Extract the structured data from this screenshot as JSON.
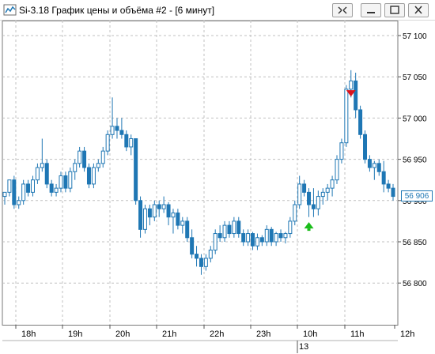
{
  "window": {
    "title": "Si-3.18 График цены и объёма #2 - [6 минут]"
  },
  "icons": {
    "app": "chart-window-icon",
    "restore": "restore-window-icon",
    "minimize": "minimize-icon",
    "maximize": "maximize-icon",
    "close": "close-icon"
  },
  "colors": {
    "candle": "#1f77b4",
    "grid": "#c0c0c0",
    "sell_signal": "#d9141e",
    "buy_signal": "#1bbd1b"
  },
  "price_axis": {
    "labels": [
      "57 100",
      "57 050",
      "57 000",
      "56 950",
      "56 900",
      "56 850",
      "56 800"
    ]
  },
  "current_price": "56 906",
  "date_label": "13",
  "chart_data": {
    "type": "candlestick",
    "ylim": [
      56760,
      57120
    ],
    "grid": true,
    "x_ticks": [
      "18h",
      "19h",
      "20h",
      "21h",
      "22h",
      "23h",
      "10h",
      "11h",
      "12h"
    ],
    "candles": [
      [
        56905,
        56908,
        56895,
        56910
      ],
      [
        56910,
        56925,
        56905,
        56925
      ],
      [
        56925,
        56930,
        56890,
        56895
      ],
      [
        56895,
        56905,
        56890,
        56900
      ],
      [
        56900,
        56925,
        56895,
        56920
      ],
      [
        56920,
        56925,
        56905,
        56910
      ],
      [
        56910,
        56930,
        56905,
        56925
      ],
      [
        56925,
        56945,
        56920,
        56940
      ],
      [
        56940,
        56975,
        56935,
        56945
      ],
      [
        56945,
        56950,
        56915,
        56920
      ],
      [
        56920,
        56925,
        56905,
        56910
      ],
      [
        56910,
        56920,
        56905,
        56915
      ],
      [
        56915,
        56935,
        56910,
        56930
      ],
      [
        56930,
        56935,
        56910,
        56915
      ],
      [
        56915,
        56940,
        56910,
        56935
      ],
      [
        56935,
        56950,
        56925,
        56945
      ],
      [
        56945,
        56965,
        56940,
        56960
      ],
      [
        56960,
        56965,
        56935,
        56940
      ],
      [
        56940,
        56945,
        56915,
        56920
      ],
      [
        56920,
        56945,
        56915,
        56940
      ],
      [
        56940,
        56950,
        56935,
        56945
      ],
      [
        56945,
        56965,
        56940,
        56960
      ],
      [
        56960,
        56985,
        56955,
        56980
      ],
      [
        56980,
        57025,
        56975,
        56990
      ],
      [
        56990,
        57000,
        56975,
        56985
      ],
      [
        56985,
        57000,
        56975,
        56980
      ],
      [
        56980,
        56985,
        56960,
        56965
      ],
      [
        56965,
        56980,
        56955,
        56975
      ],
      [
        56975,
        56975,
        56895,
        56900
      ],
      [
        56900,
        56905,
        56855,
        56865
      ],
      [
        56865,
        56895,
        56860,
        56890
      ],
      [
        56890,
        56895,
        56870,
        56880
      ],
      [
        56880,
        56900,
        56875,
        56895
      ],
      [
        56895,
        56900,
        56880,
        56890
      ],
      [
        56890,
        56905,
        56885,
        56895
      ],
      [
        56895,
        56898,
        56870,
        56880
      ],
      [
        56880,
        56890,
        56860,
        56885
      ],
      [
        56885,
        56890,
        56865,
        56870
      ],
      [
        56870,
        56880,
        56860,
        56875
      ],
      [
        56875,
        56880,
        56850,
        56855
      ],
      [
        56855,
        56865,
        56830,
        56835
      ],
      [
        56835,
        56845,
        56820,
        56830
      ],
      [
        56830,
        56835,
        56810,
        56820
      ],
      [
        56820,
        56835,
        56815,
        56830
      ],
      [
        56830,
        56845,
        56825,
        56840
      ],
      [
        56840,
        56865,
        56835,
        56860
      ],
      [
        56860,
        56870,
        56850,
        56855
      ],
      [
        56855,
        56875,
        56850,
        56870
      ],
      [
        56870,
        56875,
        56855,
        56860
      ],
      [
        56860,
        56880,
        56855,
        56875
      ],
      [
        56875,
        56880,
        56855,
        56860
      ],
      [
        56860,
        56865,
        56845,
        56850
      ],
      [
        56850,
        56865,
        56845,
        56860
      ],
      [
        56860,
        56862,
        56840,
        56845
      ],
      [
        56845,
        56860,
        56840,
        56855
      ],
      [
        56855,
        56858,
        56845,
        56850
      ],
      [
        56850,
        56870,
        56845,
        56865
      ],
      [
        56865,
        56868,
        56845,
        56850
      ],
      [
        56850,
        56862,
        56845,
        56860
      ],
      [
        56860,
        56865,
        56850,
        56855
      ],
      [
        56855,
        56862,
        56848,
        56860
      ],
      [
        56860,
        56880,
        56855,
        56875
      ],
      [
        56875,
        56900,
        56870,
        56895
      ],
      [
        56895,
        56930,
        56890,
        56920
      ],
      [
        56920,
        56925,
        56905,
        56910
      ],
      [
        56910,
        56915,
        56880,
        56895
      ],
      [
        56895,
        56915,
        56880,
        56890
      ],
      [
        56890,
        56912,
        56882,
        56905
      ],
      [
        56905,
        56915,
        56895,
        56910
      ],
      [
        56910,
        56920,
        56900,
        56915
      ],
      [
        56915,
        56930,
        56905,
        56925
      ],
      [
        56925,
        56955,
        56920,
        56950
      ],
      [
        56950,
        56975,
        56945,
        56970
      ],
      [
        56970,
        57040,
        56965,
        57035
      ],
      [
        57035,
        57058,
        57025,
        57045
      ],
      [
        57045,
        57055,
        57000,
        57010
      ],
      [
        57010,
        57015,
        56975,
        56980
      ],
      [
        56980,
        56985,
        56945,
        56950
      ],
      [
        56950,
        56955,
        56935,
        56940
      ],
      [
        56940,
        56948,
        56925,
        56945
      ],
      [
        56945,
        56950,
        56930,
        56935
      ],
      [
        56935,
        56948,
        56910,
        56920
      ],
      [
        56920,
        56925,
        56910,
        56915
      ],
      [
        56915,
        56920,
        56900,
        56905
      ]
    ],
    "signals": [
      {
        "type": "sell",
        "index": 74,
        "price": 57030
      },
      {
        "type": "buy",
        "index": 65,
        "price": 56870
      }
    ]
  }
}
